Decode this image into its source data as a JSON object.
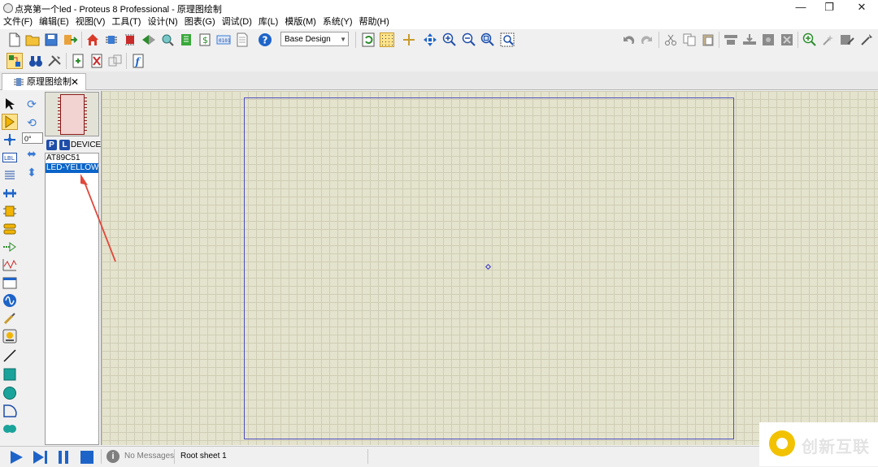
{
  "window": {
    "title": "点亮第一个led - Proteus 8 Professional - 原理图绘制",
    "minimize": "—",
    "restore": "❐",
    "close": "✕"
  },
  "menu": [
    "文件(F)",
    "编辑(E)",
    "视图(V)",
    "工具(T)",
    "设计(N)",
    "图表(G)",
    "调试(D)",
    "库(L)",
    "模版(M)",
    "系统(Y)",
    "帮助(H)"
  ],
  "toolbar": {
    "design_select": "Base Design"
  },
  "tabs": [
    {
      "label": "原理图绘制",
      "close": "✕"
    }
  ],
  "rotation": {
    "value": "0°"
  },
  "device_panel": {
    "p_button": "P",
    "l_button": "L",
    "header": "DEVICES",
    "items": [
      "AT89C51",
      "LED-YELLOW"
    ],
    "selected_index": 1
  },
  "status": {
    "messages": "No Messages",
    "sheet": "Root sheet 1"
  },
  "watermark": {
    "text": "创新互联"
  },
  "colors": {
    "canvas": "#e4e3cd",
    "sheet_border": "#4d4dc0",
    "selection": "#0a64c8",
    "annotation_arrow": "#e0483c"
  }
}
